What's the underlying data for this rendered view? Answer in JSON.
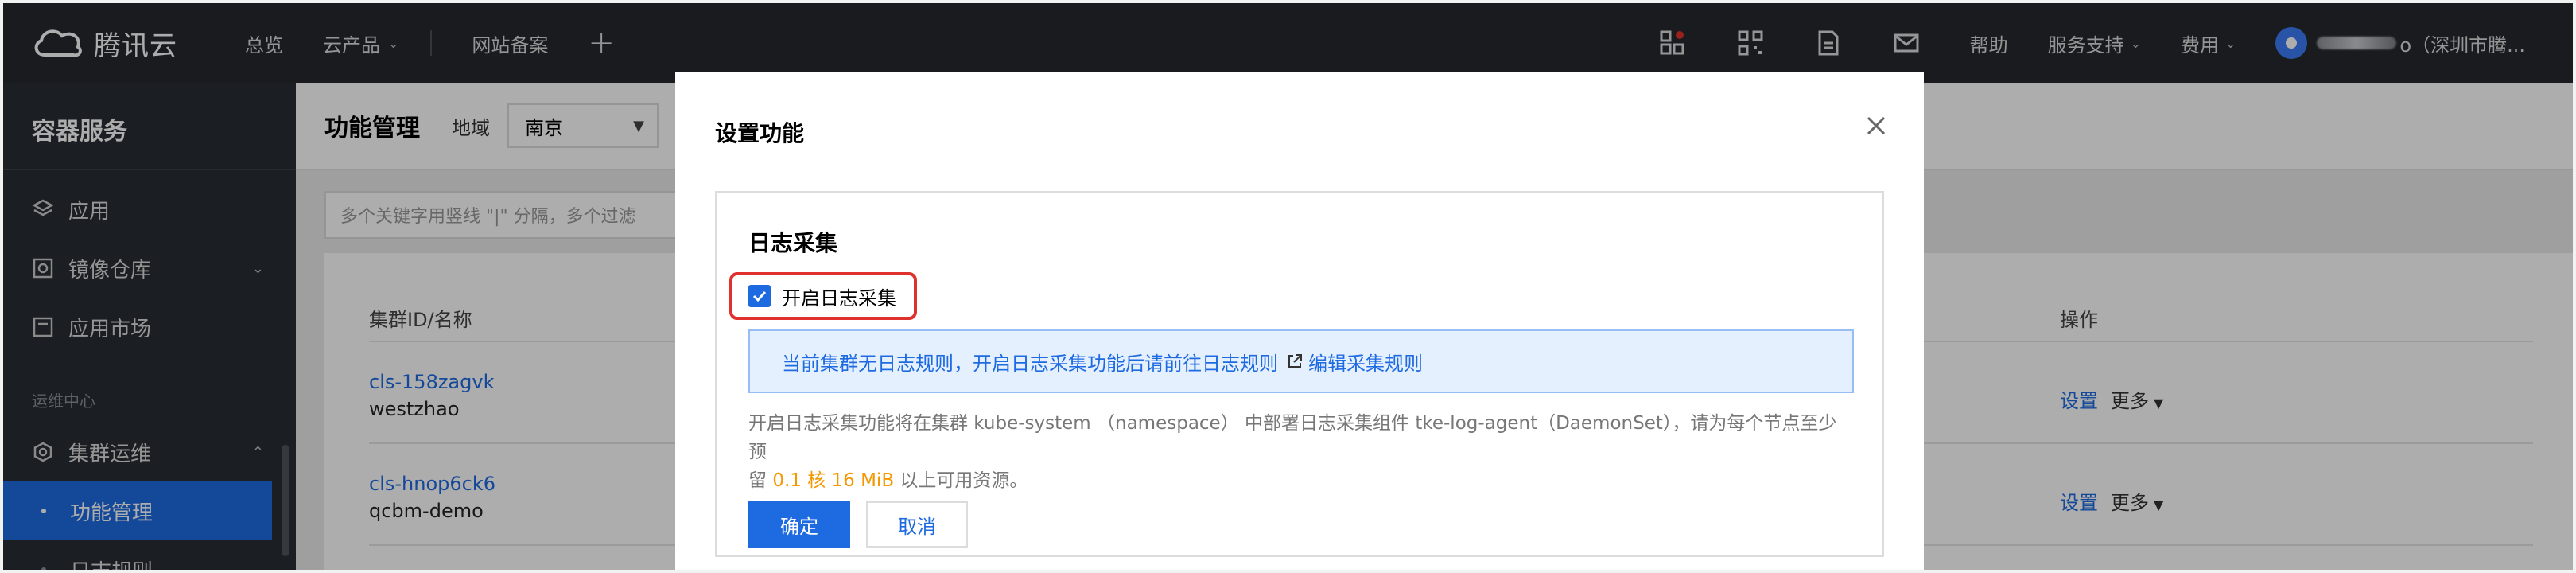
{
  "topbar": {
    "brand": "腾讯云",
    "nav": {
      "overview": "总览",
      "products": "云产品",
      "filing": "网站备案",
      "plus": "+"
    },
    "help": "帮助",
    "support": "服务支持",
    "billing": "费用",
    "user_suffix": "o（深圳市腾..."
  },
  "sidebar": {
    "title": "容器服务",
    "items": [
      {
        "label": "应用"
      },
      {
        "label": "镜像仓库"
      },
      {
        "label": "应用市场"
      }
    ],
    "group_label": "运维中心",
    "cluster_ops": "集群运维",
    "sub_items": [
      {
        "label": "功能管理"
      },
      {
        "label": "日志规则"
      }
    ]
  },
  "content": {
    "title": "功能管理",
    "region_label": "地域",
    "region_value": "南京",
    "search_placeholder": "多个关键字用竖线 \"|\" 分隔，多个过滤",
    "columns": {
      "cluster": "集群ID/名称",
      "ops": "操作"
    },
    "rows": [
      {
        "id": "cls-158zagvk",
        "name": "westzhao",
        "set": "设置",
        "more": "更多"
      },
      {
        "id": "cls-hnop6ck6",
        "name": "qcbm-demo",
        "set": "设置",
        "more": "更多"
      }
    ]
  },
  "modal": {
    "title": "设置功能",
    "section_title": "日志采集",
    "checkbox_label": "开启日志采集",
    "checkbox_checked": true,
    "info_text": "当前集群无日志规则，开启日志采集功能后请前往",
    "info_link": "日志规则",
    "info_action": "编辑采集规则",
    "desc_line1": "开启日志采集功能将在集群 kube-system （namespace） 中部署日志采集组件 tke-log-agent（DaemonSet），请为每个节点至少预",
    "desc_prefix": "留 ",
    "desc_highlight": "0.1 核 16 MiB",
    "desc_suffix": " 以上可用资源。",
    "ok": "确定",
    "cancel": "取消"
  },
  "colors": {
    "brand_blue": "#1e6ae1",
    "highlight_orange": "#f39800",
    "focus_red": "#e0322d",
    "nav_bg": "#25292e",
    "sidebar_bg": "#292d33"
  }
}
